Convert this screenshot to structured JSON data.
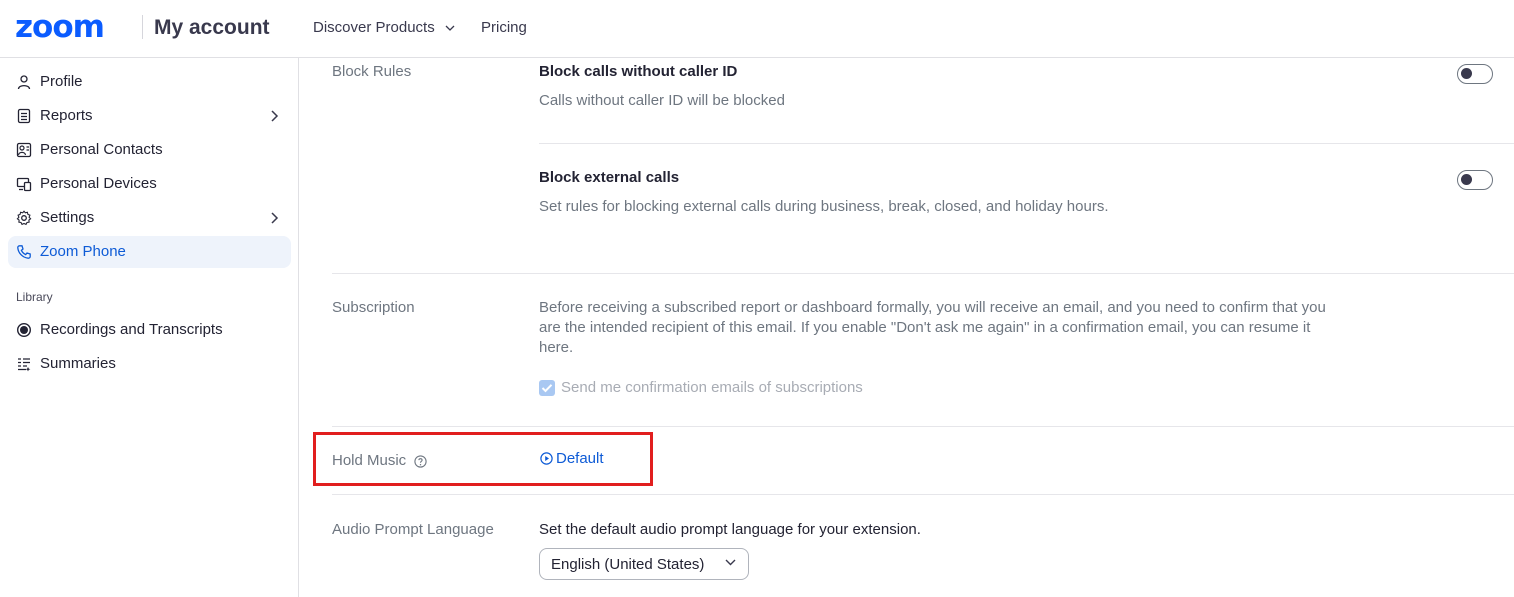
{
  "header": {
    "logo": "zoom",
    "app_title": "My account",
    "nav": [
      {
        "label": "Discover Products",
        "has_dropdown": true
      },
      {
        "label": "Pricing",
        "has_dropdown": false
      }
    ]
  },
  "sidebar": {
    "items": [
      {
        "label": "Profile",
        "icon": "person-icon"
      },
      {
        "label": "Reports",
        "icon": "clipboard-icon",
        "has_arrow": true
      },
      {
        "label": "Personal Contacts",
        "icon": "contacts-icon"
      },
      {
        "label": "Personal Devices",
        "icon": "devices-icon"
      },
      {
        "label": "Settings",
        "icon": "gear-icon",
        "has_arrow": true
      },
      {
        "label": "Zoom Phone",
        "icon": "phone-icon",
        "active": true
      }
    ],
    "library_label": "Library",
    "library_items": [
      {
        "label": "Recordings and Transcripts",
        "icon": "record-icon"
      },
      {
        "label": "Summaries",
        "icon": "summaries-icon"
      }
    ]
  },
  "main": {
    "block_rules": {
      "label": "Block Rules",
      "items": [
        {
          "title": "Block calls without caller ID",
          "description": "Calls without caller ID will be blocked",
          "enabled": false
        },
        {
          "title": "Block external calls",
          "description": "Set rules for blocking external calls during business, break, closed, and holiday hours.",
          "enabled": false
        }
      ]
    },
    "subscription": {
      "label": "Subscription",
      "description_lines": [
        "Before receiving a subscribed report or dashboard formally, you will receive an email, and you need to confirm that you",
        "are the intended recipient of this email. If you enable \"Don't ask me again\" in a confirmation email, you can resume it",
        "here."
      ],
      "checkbox_label": "Send me confirmation emails of subscriptions",
      "checkbox_checked": true,
      "checkbox_disabled": true
    },
    "hold_music": {
      "label": "Hold Music",
      "value": "Default"
    },
    "audio_prompt": {
      "label": "Audio Prompt Language",
      "description": "Set the default audio prompt language for your extension.",
      "selected": "English (United States)"
    }
  },
  "colors": {
    "brand": "#0b5cff",
    "link": "#0e5bd6",
    "active_bg": "#eef3fb",
    "highlight_border": "#e11e1e"
  }
}
